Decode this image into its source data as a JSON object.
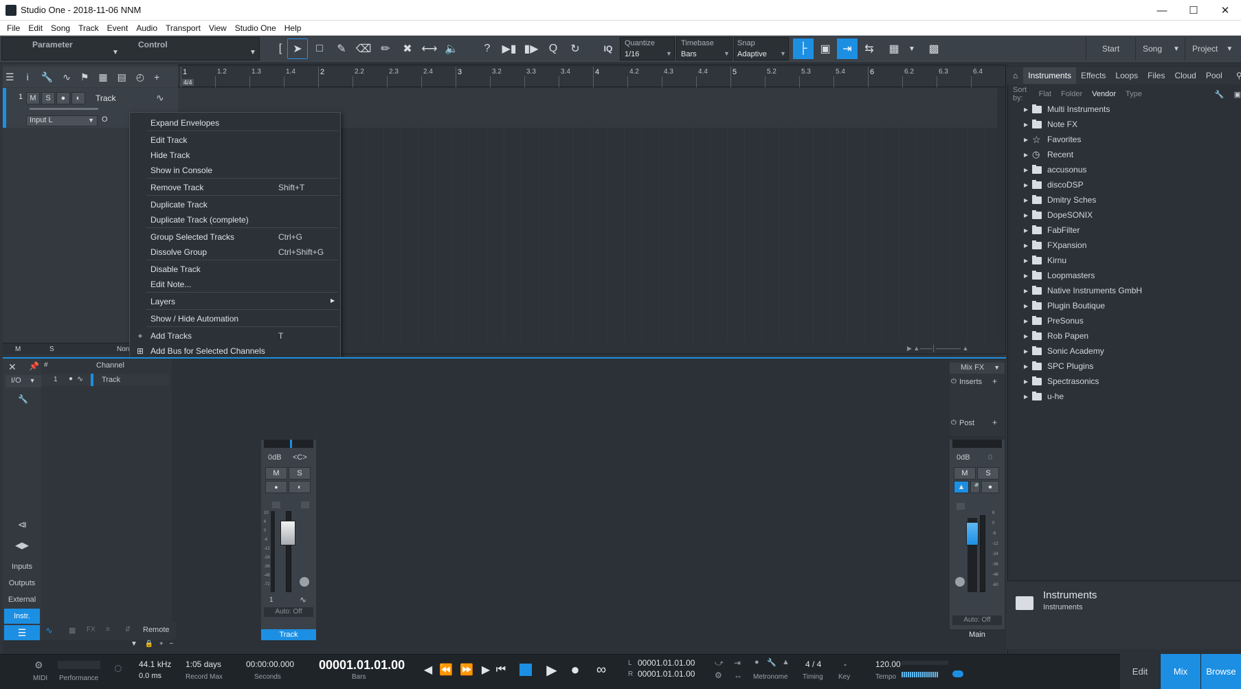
{
  "window": {
    "title": "Studio One - 2018-11-06 NNM"
  },
  "menu": [
    "File",
    "Edit",
    "Song",
    "Track",
    "Event",
    "Audio",
    "Transport",
    "View",
    "Studio One",
    "Help"
  ],
  "toolbar": {
    "parameter_label": "Parameter",
    "control_label": "Control",
    "iq_label": "IQ",
    "quantize": {
      "label": "Quantize",
      "value": "1/16"
    },
    "timebase": {
      "label": "Timebase",
      "value": "Bars"
    },
    "snap": {
      "label": "Snap",
      "value": "Adaptive"
    },
    "start_label": "Start",
    "song_label": "Song",
    "project_label": "Project"
  },
  "ruler": {
    "marks": [
      "1",
      "1.2",
      "1.3",
      "1.4",
      "2",
      "2.2",
      "2.3",
      "2.4",
      "3",
      "3.2",
      "3.3",
      "3.4",
      "4",
      "4.2",
      "4.3",
      "4.4",
      "5",
      "5.2",
      "5.3",
      "5.4",
      "6",
      "6.2",
      "6.3",
      "6.4"
    ],
    "time_sig": "4/4"
  },
  "track": {
    "number": "1",
    "mute": "M",
    "solo": "S",
    "name": "Track",
    "input": "Input L",
    "monitor": "O"
  },
  "track_footer": {
    "m": "M",
    "s": "S",
    "none": "Non"
  },
  "context_menu": [
    {
      "label": "Expand Envelopes",
      "shortcut": "",
      "icon": "",
      "sep_after": true
    },
    {
      "label": "Edit Track",
      "shortcut": "",
      "icon": ""
    },
    {
      "label": "Hide Track",
      "shortcut": "",
      "icon": ""
    },
    {
      "label": "Show in Console",
      "shortcut": "",
      "icon": "",
      "sep_after": true
    },
    {
      "label": "Remove Track",
      "shortcut": "Shift+T",
      "icon": "",
      "sep_after": true
    },
    {
      "label": "Duplicate Track",
      "shortcut": "",
      "icon": ""
    },
    {
      "label": "Duplicate Track (complete)",
      "shortcut": "",
      "icon": "",
      "sep_after": true
    },
    {
      "label": "Group Selected Tracks",
      "shortcut": "Ctrl+G",
      "icon": ""
    },
    {
      "label": "Dissolve Group",
      "shortcut": "Ctrl+Shift+G",
      "icon": "",
      "sep_after": true
    },
    {
      "label": "Disable Track",
      "shortcut": "",
      "icon": ""
    },
    {
      "label": "Edit Note...",
      "shortcut": "",
      "icon": "",
      "sep_after": true
    },
    {
      "label": "Layers",
      "shortcut": "",
      "icon": "",
      "submenu": true,
      "sep_after": true
    },
    {
      "label": "Show / Hide Automation",
      "shortcut": "",
      "icon": "",
      "sep_after": true
    },
    {
      "label": "Add Tracks",
      "shortcut": "T",
      "icon": "+"
    },
    {
      "label": "Add Bus for Selected Channels",
      "shortcut": "",
      "icon": "⊞"
    },
    {
      "label": "Add VCA for Selected Channels",
      "shortcut": "",
      "icon": "⊕"
    },
    {
      "label": "Pack Folder",
      "shortcut": "",
      "icon": "▤"
    },
    {
      "label": "Collapse All Tracks",
      "shortcut": "",
      "icon": "▲"
    },
    {
      "label": "Remove Track Automation",
      "shortcut": "",
      "icon": "⊘"
    },
    {
      "label": "Apply Track Names to Channels",
      "shortcut": "",
      "icon": "▦"
    }
  ],
  "browser": {
    "tabs": [
      "Instruments",
      "Effects",
      "Loops",
      "Files",
      "Cloud",
      "Pool"
    ],
    "active_tab": "Instruments",
    "sort_label": "Sort by:",
    "sort_options": [
      "Flat",
      "Folder",
      "Vendor",
      "Type"
    ],
    "sort_active": "Vendor",
    "items": [
      "Multi Instruments",
      "Note FX",
      "Favorites",
      "Recent",
      "accusonus",
      "discoDSP",
      "Dmitry Sches",
      "DopeSONIX",
      "FabFilter",
      "FXpansion",
      "Kirnu",
      "Loopmasters",
      "Native Instruments GmbH",
      "Plugin Boutique",
      "PreSonus",
      "Rob Papen",
      "Sonic Academy",
      "SPC Plugins",
      "Spectrasonics",
      "u-he"
    ],
    "info_title": "Instruments",
    "info_sub": "Instruments"
  },
  "console": {
    "io_label": "I/O",
    "channel_header": "Channel",
    "hash": "#",
    "channel_row": {
      "num": "1",
      "name": "Track"
    },
    "side_buttons": [
      "Inputs",
      "Outputs",
      "External",
      "Instr."
    ],
    "remote_label": "Remote",
    "bottom_icons": [
      "FX"
    ],
    "strip": {
      "gain": "0dB",
      "pan": "<C>",
      "m": "M",
      "s": "S",
      "num": "1",
      "auto": "Auto: Off",
      "name": "Track"
    },
    "main": {
      "mixfx": "Mix FX",
      "inserts": "Inserts",
      "post": "Post",
      "gain": "0dB",
      "pan": "0",
      "m": "M",
      "s": "S",
      "auto": "Auto: Off",
      "name": "Main"
    },
    "scale_left": [
      "10",
      "6",
      "0",
      "-6",
      "-12",
      "-24",
      "-36",
      "-48",
      "-72"
    ],
    "scale_right": [
      "6",
      "0",
      "-6",
      "-12",
      "-24",
      "-36",
      "-48",
      "-60"
    ]
  },
  "transport": {
    "midi": "MIDI",
    "performance": "Performance",
    "sample_rate": "44.1 kHz",
    "latency": "0.0 ms",
    "record_max_value": "1:05 days",
    "record_max_label": "Record Max",
    "seconds_value": "00:00:00.000",
    "seconds_label": "Seconds",
    "bars_value": "00001.01.01.00",
    "bars_label": "Bars",
    "loop_l": "00001.01.01.00",
    "loop_r": "00001.01.01.00",
    "l": "L",
    "r": "R",
    "metronome_label": "Metronome",
    "timing_value": "4 / 4",
    "timing_label": "Timing",
    "key_value": "-",
    "key_label": "Key",
    "tempo_value": "120.00",
    "tempo_label": "Tempo",
    "nav": [
      "Edit",
      "Mix",
      "Browse"
    ],
    "nav_active": [
      "Mix",
      "Browse"
    ]
  }
}
